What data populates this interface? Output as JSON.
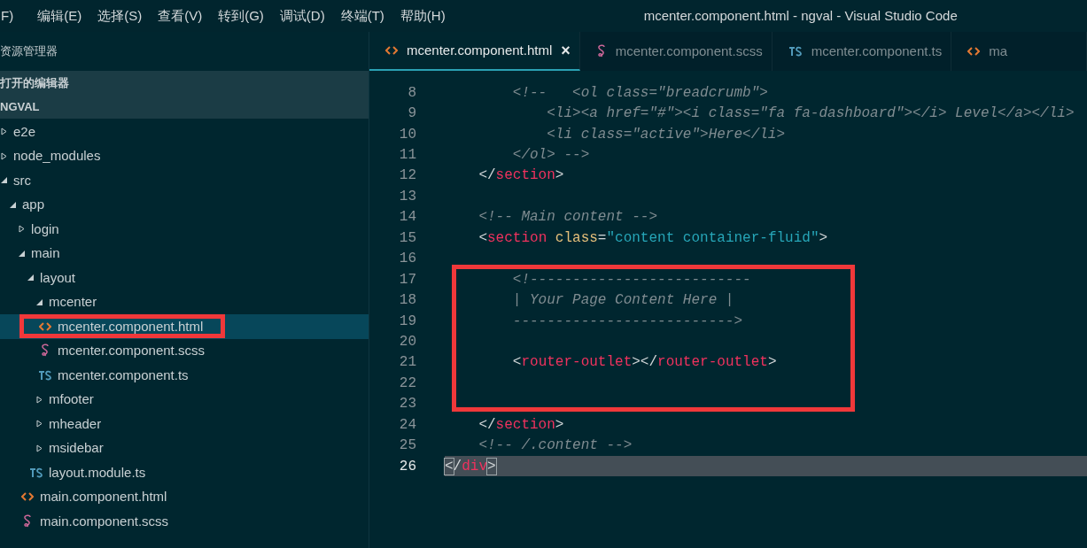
{
  "menu_bar": {
    "items": [
      "F)",
      "编辑(E)",
      "选择(S)",
      "查看(V)",
      "转到(G)",
      "调试(D)",
      "终端(T)",
      "帮助(H)"
    ]
  },
  "window": {
    "title": "mcenter.component.html - ngval - Visual Studio Code"
  },
  "sidebar": {
    "title": "资源管理器",
    "sections": [
      "打开的编辑器",
      "NGVAL"
    ],
    "tree": [
      {
        "kind": "folder",
        "label": "e2e",
        "expanded": false
      },
      {
        "kind": "folder",
        "label": "node_modules",
        "expanded": false
      },
      {
        "kind": "folder",
        "label": "src",
        "expanded": true,
        "children": [
          {
            "kind": "folder",
            "label": "app",
            "expanded": true,
            "children": [
              {
                "kind": "folder",
                "label": "login",
                "expanded": false
              },
              {
                "kind": "folder",
                "label": "main",
                "expanded": true,
                "children": [
                  {
                    "kind": "folder",
                    "label": "layout",
                    "expanded": true,
                    "children": [
                      {
                        "kind": "folder",
                        "label": "mcenter",
                        "expanded": true,
                        "children": [
                          {
                            "kind": "html",
                            "label": "mcenter.component.html",
                            "selected": true
                          },
                          {
                            "kind": "scss",
                            "label": "mcenter.component.scss",
                            "selected": false
                          },
                          {
                            "kind": "ts",
                            "label": "mcenter.component.ts",
                            "selected": false
                          }
                        ]
                      },
                      {
                        "kind": "folder",
                        "label": "mfooter",
                        "expanded": false
                      },
                      {
                        "kind": "folder",
                        "label": "mheader",
                        "expanded": false
                      },
                      {
                        "kind": "folder",
                        "label": "msidebar",
                        "expanded": false
                      },
                      {
                        "kind": "ts",
                        "label": "layout.module.ts",
                        "selected": false
                      }
                    ]
                  },
                  {
                    "kind": "html",
                    "label": "main.component.html",
                    "selected": false
                  },
                  {
                    "kind": "scss",
                    "label": "main.component.scss",
                    "selected": false
                  }
                ]
              }
            ]
          }
        ]
      }
    ]
  },
  "tabs": [
    {
      "kind": "html",
      "label": "mcenter.component.html",
      "selected": true,
      "close": "×"
    },
    {
      "kind": "scss",
      "label": "mcenter.component.scss",
      "selected": false
    },
    {
      "kind": "ts",
      "label": "mcenter.component.ts",
      "selected": false
    },
    {
      "kind": "html",
      "label": "ma",
      "selected": false
    }
  ],
  "editor": {
    "lines": [
      {
        "number": "8",
        "tokens": [
          {
            "kind": "comment",
            "text": "        <!--   <ol class=\"breadcrumb\">"
          }
        ]
      },
      {
        "number": "9",
        "tokens": [
          {
            "kind": "comment",
            "text": "            <li><a href=\"#\"><i class=\"fa fa-dashboard\"></i> Level</a></li>"
          }
        ]
      },
      {
        "number": "10",
        "tokens": [
          {
            "kind": "comment",
            "text": "            <li class=\"active\">Here</li>"
          }
        ]
      },
      {
        "number": "11",
        "tokens": [
          {
            "kind": "comment",
            "text": "        </ol> -->"
          }
        ]
      },
      {
        "number": "12",
        "tokens": [
          {
            "kind": "punct",
            "text": "    </"
          },
          {
            "kind": "tag",
            "text": "section"
          },
          {
            "kind": "punct",
            "text": ">"
          }
        ]
      },
      {
        "number": "13"
      },
      {
        "number": "14",
        "tokens": [
          {
            "kind": "comment",
            "text": "    <!-- Main content -->"
          }
        ]
      },
      {
        "number": "15",
        "tokens": [
          {
            "kind": "punct",
            "text": "    <"
          },
          {
            "kind": "tag",
            "text": "section"
          },
          {
            "kind": "attr",
            "text": " class"
          },
          {
            "kind": "punct",
            "text": "="
          },
          {
            "kind": "string",
            "text": "\"content container-fluid\""
          },
          {
            "kind": "punct",
            "text": ">"
          }
        ]
      },
      {
        "number": "16"
      },
      {
        "number": "17",
        "tokens": [
          {
            "kind": "comment",
            "text": "        <!--------------------------"
          }
        ]
      },
      {
        "number": "18",
        "tokens": [
          {
            "kind": "comment",
            "text": "        | Your Page Content Here |"
          }
        ]
      },
      {
        "number": "19",
        "tokens": [
          {
            "kind": "comment",
            "text": "        -------------------------->"
          }
        ]
      },
      {
        "number": "20"
      },
      {
        "number": "21",
        "tokens": [
          {
            "kind": "punct",
            "text": "        <"
          },
          {
            "kind": "tag",
            "text": "router-outlet"
          },
          {
            "kind": "punct",
            "text": "></"
          },
          {
            "kind": "tag",
            "text": "router-outlet"
          },
          {
            "kind": "punct",
            "text": ">"
          }
        ]
      },
      {
        "number": "22"
      },
      {
        "number": "23"
      },
      {
        "number": "24",
        "tokens": [
          {
            "kind": "punct",
            "text": "    </"
          },
          {
            "kind": "tag",
            "text": "section"
          },
          {
            "kind": "punct",
            "text": ">"
          }
        ]
      },
      {
        "number": "25",
        "tokens": [
          {
            "kind": "comment",
            "text": "    <!-- /.content -->"
          }
        ]
      },
      {
        "number": "26",
        "current": true,
        "tokens": [
          {
            "kind": "bracket",
            "text": "<"
          },
          {
            "kind": "punct",
            "text": "/"
          },
          {
            "kind": "tag",
            "text": "div"
          },
          {
            "kind": "bracket",
            "text": ">"
          }
        ]
      }
    ]
  }
}
